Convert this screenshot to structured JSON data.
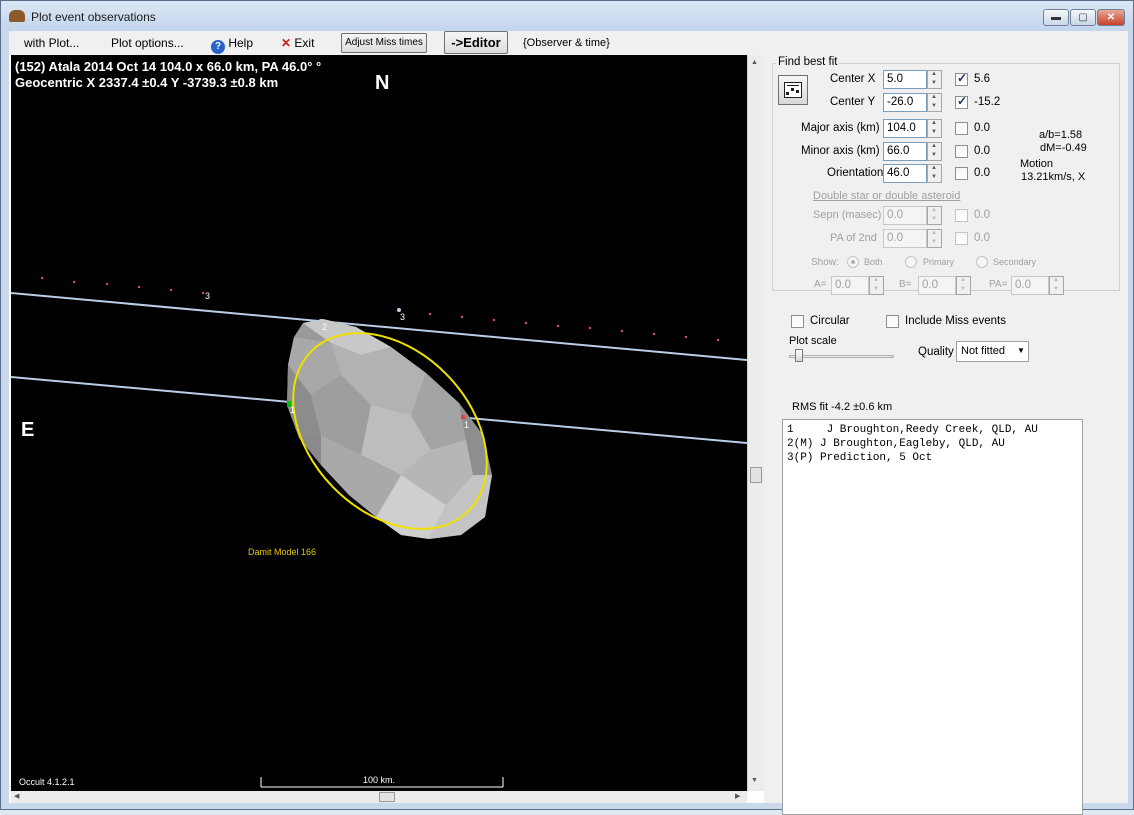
{
  "window": {
    "title": "Plot event observations",
    "min_glyph": "▬",
    "max_glyph": "▢",
    "close_glyph": "✕"
  },
  "menu": {
    "with_plot": "with Plot...",
    "plot_options": "Plot options...",
    "help": "Help",
    "exit": "Exit",
    "adjust_miss": "Adjust Miss times",
    "editor": "->Editor",
    "observer_time": "{Observer & time}"
  },
  "plot": {
    "header1": "(152) Atala  2014 Oct 14  104.0 x 66.0 km, PA 46.0° °",
    "header2": "Geocentric  X  2337.4 ±0.4  Y -3739.3 ±0.8 km",
    "north": "N",
    "east": "E",
    "model_label": "Damit Model 166",
    "version": "Occult 4.1.2.1",
    "scale_label": "100 km.",
    "chord_labels": [
      "1",
      "1",
      "2",
      "3",
      "3"
    ],
    "colors": {
      "chord": "#b9cde6",
      "ellipse": "#f0e000",
      "model_label": "#e8c800",
      "miss_dot": "#e05050"
    }
  },
  "panel": {
    "find_best_fit": "Find best fit",
    "center_x_label": "Center X",
    "center_x_value": "5.0",
    "center_x_fit": "5.6",
    "center_y_label": "Center Y",
    "center_y_value": "-26.0",
    "center_y_fit": "-15.2",
    "major_label": "Major axis (km)",
    "major_value": "104.0",
    "major_fit": "0.0",
    "minor_label": "Minor axis (km)",
    "minor_value": "66.0",
    "minor_fit": "0.0",
    "orient_label": "Orientation",
    "orient_value": "46.0",
    "orient_fit": "0.0",
    "ab_ratio": "a/b=1.58",
    "dm": "dM=-0.49",
    "motion_label": "Motion",
    "motion_value": "13.21km/s, X",
    "double_header": "Double star  or  double asteroid",
    "sepn_label": "Sepn (masec)",
    "sepn_value": "0.0",
    "sepn_fit": "0.0",
    "pa2_label": "PA of 2nd",
    "pa2_value": "0.0",
    "pa2_fit": "0.0",
    "show_label": "Show:",
    "show_both": "Both",
    "show_primary": "Primary",
    "show_secondary": "Secondary",
    "a_label": "A=",
    "a_value": "0.0",
    "b_label": "B=",
    "b_value": "0.0",
    "pa_label": "PA=",
    "pa_value": "0.0",
    "circular": "Circular",
    "include_miss": "Include Miss events",
    "plot_scale": "Plot scale",
    "quality_label": "Quality",
    "quality_value": "Not fitted",
    "rms_fit": "RMS fit  -4.2 ±0.6 km",
    "observers": [
      "1     J Broughton,Reedy Creek, QLD, AU",
      "2(M) J Broughton,Eagleby, QLD, AU",
      "3(P) Prediction, 5 Oct"
    ]
  }
}
